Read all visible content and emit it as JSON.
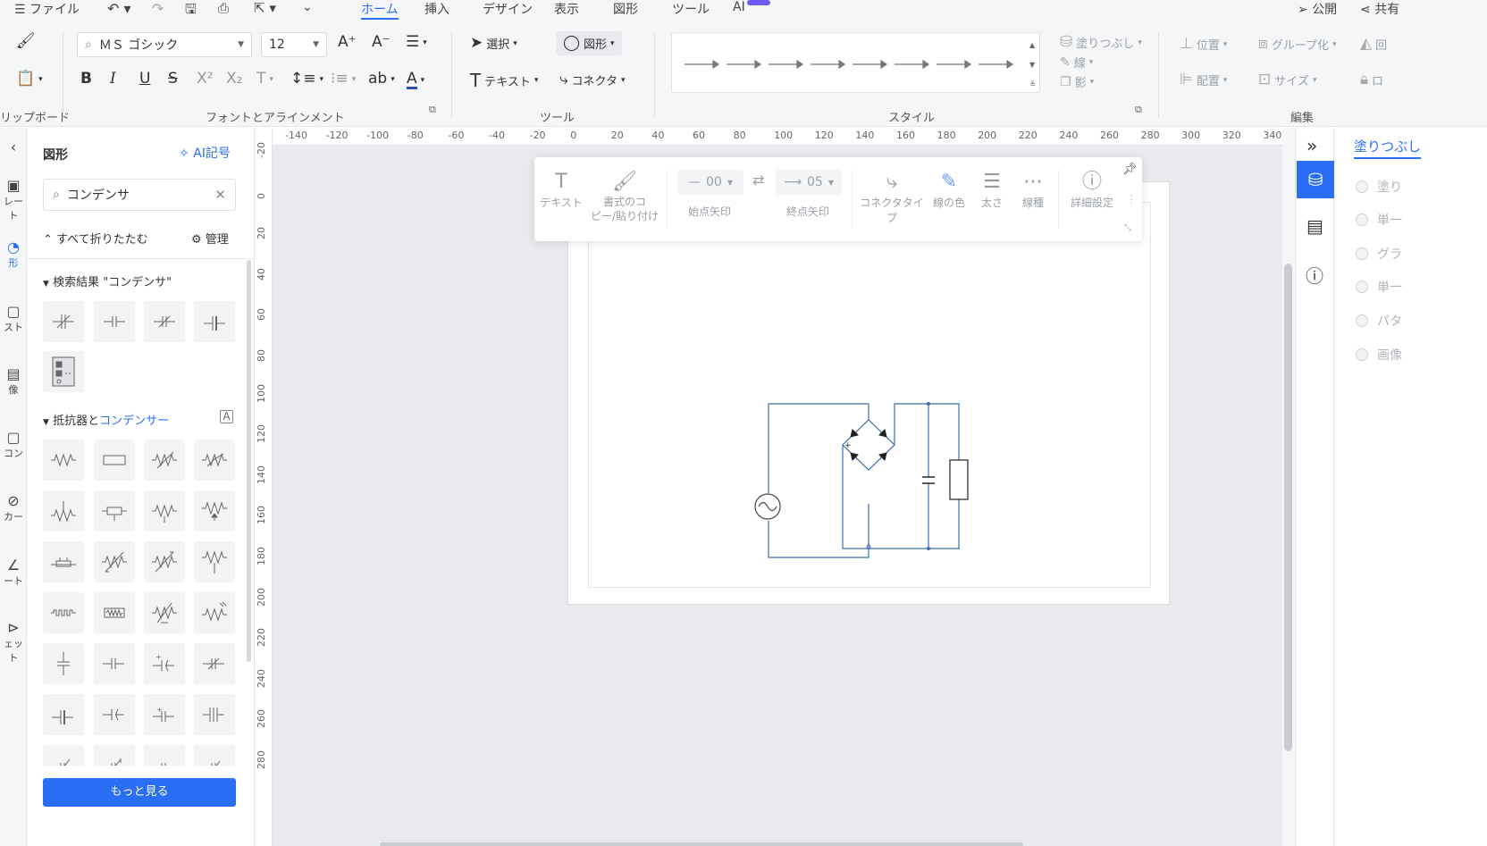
{
  "menu": {
    "file": "ファイル",
    "tabs": [
      "ホーム",
      "挿入",
      "デザイン",
      "表示",
      "図形",
      "ツール",
      "AI"
    ],
    "publish": "公開",
    "share": "共有"
  },
  "ribbon": {
    "groups": {
      "clipboard": "リップボード",
      "font": "フォントとアラインメント",
      "tools": "ツール",
      "style": "スタイル",
      "edit": "編集"
    },
    "font_name": "ＭＳ ゴシック",
    "font_size": "12",
    "select": "選択",
    "shape": "図形",
    "text": "テキスト",
    "connector": "コネクタ",
    "fill": "塗りつぶし",
    "line": "線",
    "shadow": "影",
    "position": "位置",
    "group": "グループ化",
    "rotate": "回",
    "align": "配置",
    "size": "サイズ",
    "lock": "ロ"
  },
  "leftrail": {
    "items": [
      "レート",
      "形",
      "スト",
      "像",
      "コン",
      "カー",
      "ート",
      "ェット"
    ]
  },
  "panel": {
    "title": "図形",
    "ai_button": "AI記号",
    "search_value": "コンデンサ",
    "collapse_all": "すべて折りたたむ",
    "manage": "管理",
    "results_title": "検索結果 \"コンデンサ\"",
    "category_prefix": "抵抗器と",
    "category_link": "コンデンサー",
    "more_button": "もっと見る"
  },
  "rulers": {
    "h": [
      "-140",
      "-120",
      "-100",
      "-80",
      "-60",
      "-40",
      "-20",
      "0",
      "20",
      "40",
      "60",
      "80",
      "100",
      "120",
      "140",
      "160",
      "180",
      "200",
      "220",
      "240",
      "260",
      "280",
      "300",
      "320",
      "340"
    ],
    "v": [
      "-20",
      "0",
      "20",
      "40",
      "60",
      "80",
      "100",
      "120",
      "140",
      "160",
      "180",
      "200",
      "220",
      "240",
      "260",
      "280"
    ]
  },
  "floatbar": {
    "text": "テキスト",
    "format_copy": "書式のコ\nピー/貼り付け",
    "start_value": "00",
    "end_value": "05",
    "start_arrow": "始点矢印",
    "end_arrow": "終点矢印",
    "connector_type": "コネクタタイプ",
    "line_color": "線の色",
    "thickness": "太さ",
    "line_type": "線種",
    "details": "詳細設定"
  },
  "rightpanel": {
    "title": "塗りつぶし",
    "options": [
      "塗り",
      "単一",
      "グラ",
      "単一",
      "パタ",
      "画像"
    ]
  },
  "colors": {
    "accent": "#2b6ef6",
    "circuit": "#3a6fb0"
  }
}
